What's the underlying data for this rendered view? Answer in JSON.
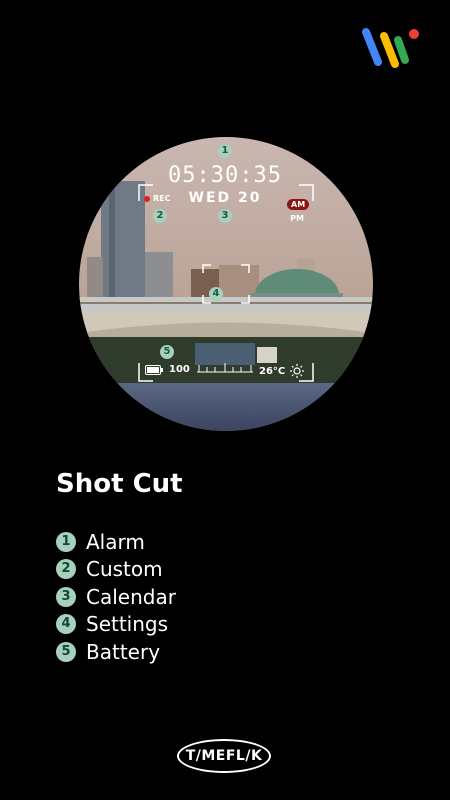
{
  "logo": {
    "name": "wear-os-logo",
    "colors": [
      "#4285F4",
      "#FBBC05",
      "#34A853",
      "#EA4335"
    ]
  },
  "watch": {
    "time": "05:30:35",
    "date": "WED 20",
    "rec_label": "REC",
    "am_label": "AM",
    "pm_label": "PM",
    "battery_value": "100",
    "temperature": "26°C",
    "markers": [
      "1",
      "2",
      "3",
      "4",
      "5"
    ]
  },
  "info": {
    "title": "Shot Cut",
    "features": [
      {
        "num": "1",
        "label": "Alarm"
      },
      {
        "num": "2",
        "label": "Custom"
      },
      {
        "num": "3",
        "label": "Calendar"
      },
      {
        "num": "4",
        "label": "Settings"
      },
      {
        "num": "5",
        "label": "Battery"
      }
    ]
  },
  "brand": {
    "label": "T/MEFL/K"
  },
  "colors": {
    "background": "#000000",
    "marker": "#a7d0bd",
    "marker_text": "#1f5a44",
    "rec": "#e21d1d",
    "am_badge": "#8b1515"
  }
}
